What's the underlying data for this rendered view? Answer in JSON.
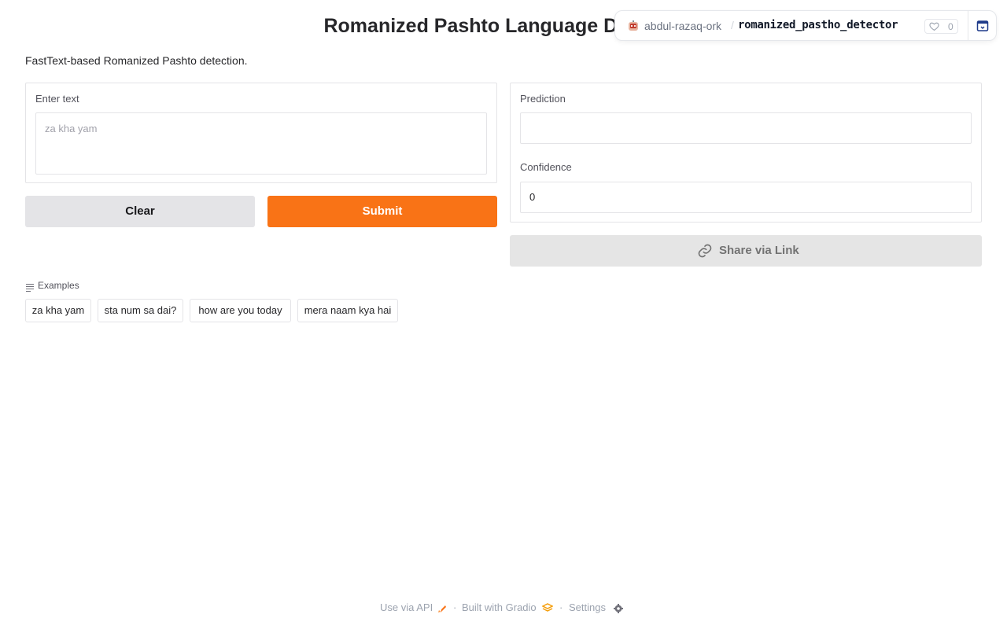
{
  "header": {
    "title": "Romanized Pashto Language Detector",
    "description": "FastText-based Romanized Pashto detection."
  },
  "hf_badge": {
    "owner": "abdul-razaq-ork",
    "separator": "/",
    "repo": "romanized_pastho_detector",
    "likes": "0",
    "avatar_icon": "robot-avatar-icon",
    "embed_icon": "embed-window-icon"
  },
  "input": {
    "label": "Enter text",
    "placeholder": "za kha yam",
    "value": ""
  },
  "buttons": {
    "clear": "Clear",
    "submit": "Submit",
    "share": "Share via Link"
  },
  "output": {
    "prediction_label": "Prediction",
    "prediction_value": "",
    "confidence_label": "Confidence",
    "confidence_value": "0"
  },
  "examples": {
    "heading": "Examples",
    "items": [
      "za kha yam",
      "sta num sa dai?",
      "how are you today",
      "mera naam kya hai"
    ]
  },
  "footer": {
    "api": "Use via API",
    "built": "Built with Gradio",
    "settings": "Settings",
    "separator": "·"
  },
  "colors": {
    "primary": "#f97316",
    "secondary_button": "#e4e4e7",
    "border": "#e4e4e7"
  }
}
